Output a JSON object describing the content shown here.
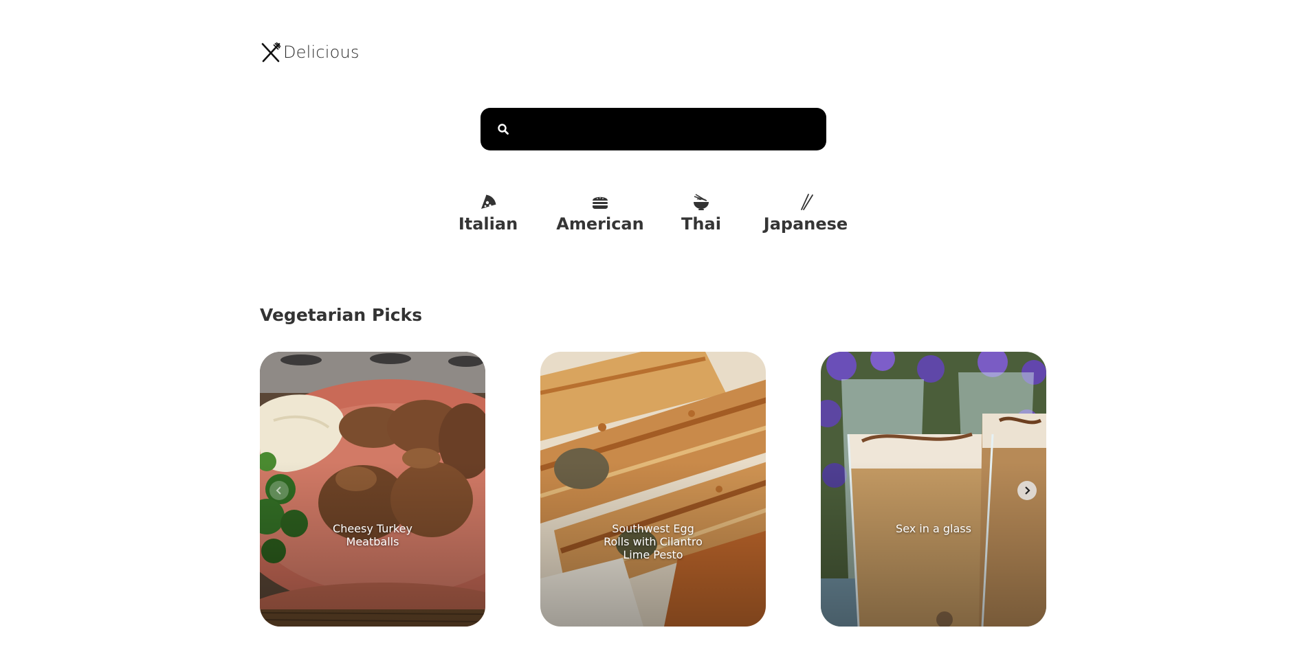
{
  "brand": {
    "name": "Delicious",
    "icon": "fork-knife-icon"
  },
  "search": {
    "value": "",
    "placeholder": "",
    "icon": "search-icon",
    "background": "#000000"
  },
  "cuisines": [
    {
      "label": "Italian",
      "icon": "pizza-icon"
    },
    {
      "label": "American",
      "icon": "burger-icon"
    },
    {
      "label": "Thai",
      "icon": "noodle-bowl-icon"
    },
    {
      "label": "Japanese",
      "icon": "chopsticks-icon"
    }
  ],
  "section": {
    "title": "Vegetarian Picks"
  },
  "recipes": [
    {
      "title": "Cheesy Turkey Meatballs"
    },
    {
      "title": "Southwest Egg Rolls with Cilantro Lime Pesto"
    },
    {
      "title": "Sex in a glass"
    }
  ],
  "carousel": {
    "prev_icon": "chevron-left-icon",
    "next_icon": "chevron-right-icon"
  }
}
